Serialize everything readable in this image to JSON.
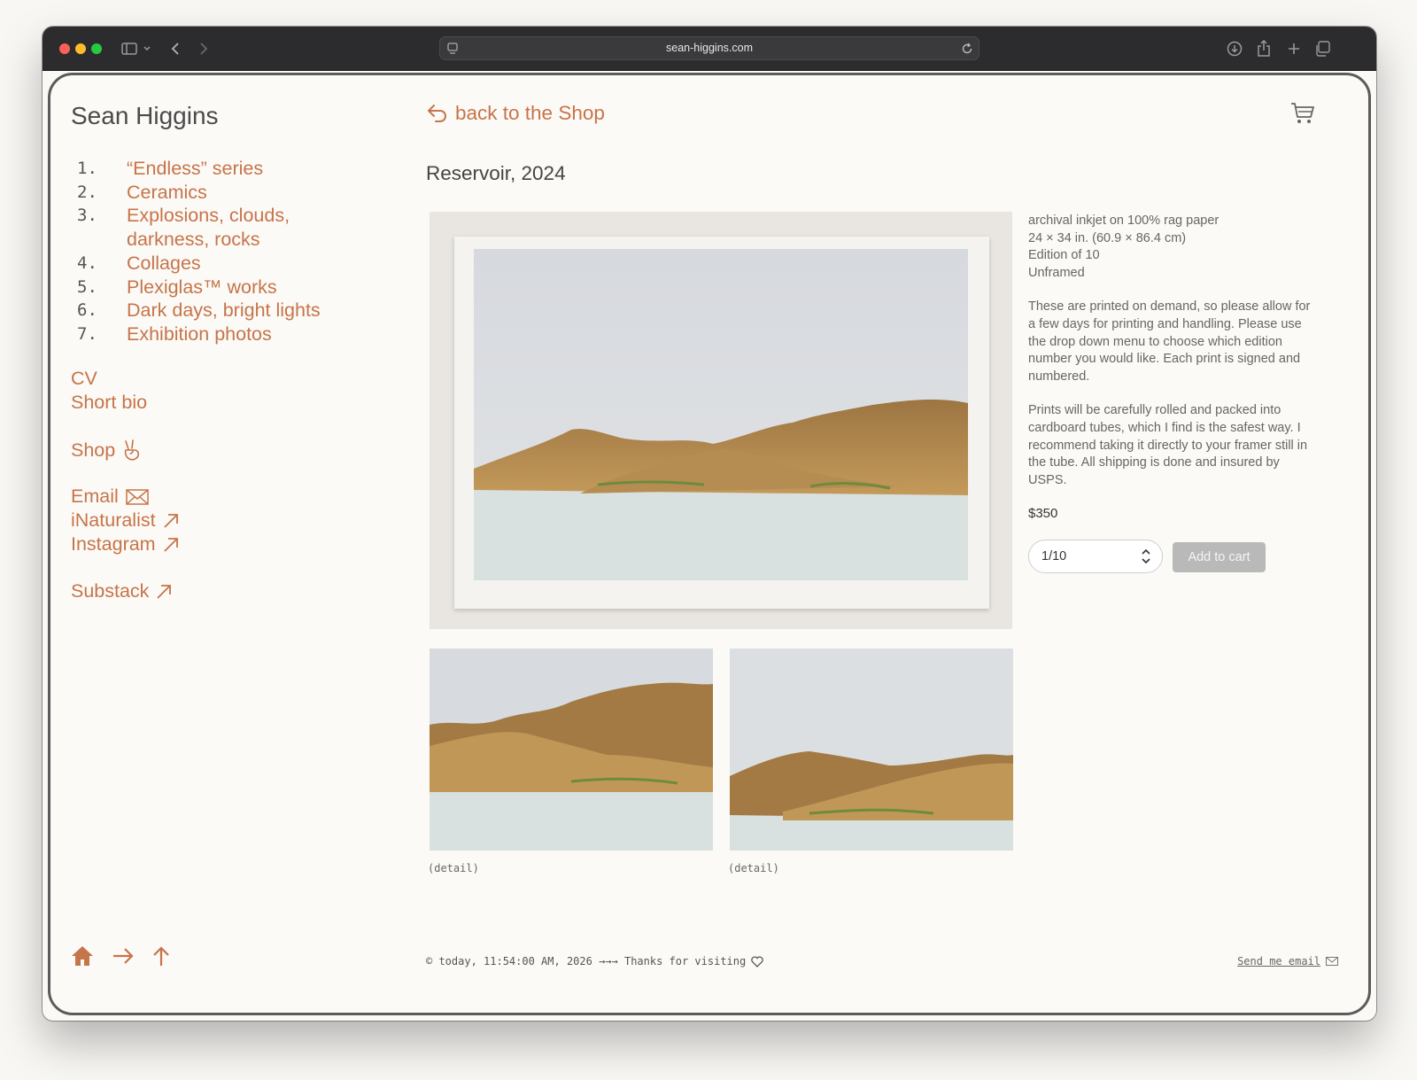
{
  "browser": {
    "url": "sean-higgins.com"
  },
  "site": {
    "title": "Sean Higgins"
  },
  "nav": {
    "series": [
      {
        "num": "1.",
        "label": "“Endless” series"
      },
      {
        "num": "2.",
        "label": "Ceramics"
      },
      {
        "num": "3.",
        "label": "Explosions, clouds,"
      },
      {
        "num": "",
        "label": "darkness, rocks"
      },
      {
        "num": "4.",
        "label": "Collages"
      },
      {
        "num": "5.",
        "label": "Plexiglas™ works"
      },
      {
        "num": "6.",
        "label": "Dark days, bright lights"
      },
      {
        "num": "7.",
        "label": "Exhibition photos"
      }
    ],
    "cv": "CV",
    "bio": "Short bio",
    "shop": "Shop",
    "email": "Email",
    "inaturalist": "iNaturalist",
    "instagram": "Instagram",
    "substack": "Substack"
  },
  "header": {
    "back_label": "back to the Shop"
  },
  "product": {
    "title": "Reservoir, 2024",
    "medium": "archival inkjet on 100% rag paper",
    "size": "24 × 34 in. (60.9 × 86.4 cm)",
    "edition": "Edition of 10",
    "framing": "Unframed",
    "note1": "These are printed on demand, so please allow for a few days for printing and handling. Please use the drop down menu to choose which edition number you would like. Each print is signed and numbered.",
    "note2": "Prints will be carefully rolled and packed into cardboard tubes, which I find is the safest way. I recommend taking it directly to your framer still in the tube. All shipping is done and insured by USPS.",
    "price": "$350",
    "edition_selected": "1/10",
    "add_to_cart": "Add to cart",
    "detail_caption_1": "(detail)",
    "detail_caption_2": "(detail)"
  },
  "footer": {
    "copyright": "© today, 11:54:00 AM, 2026 →→→ Thanks for visiting",
    "send_email": "Send me email"
  },
  "colors": {
    "accent": "#c6744a",
    "text": "#4b4b4b",
    "page_bg": "#fcfaf6"
  }
}
